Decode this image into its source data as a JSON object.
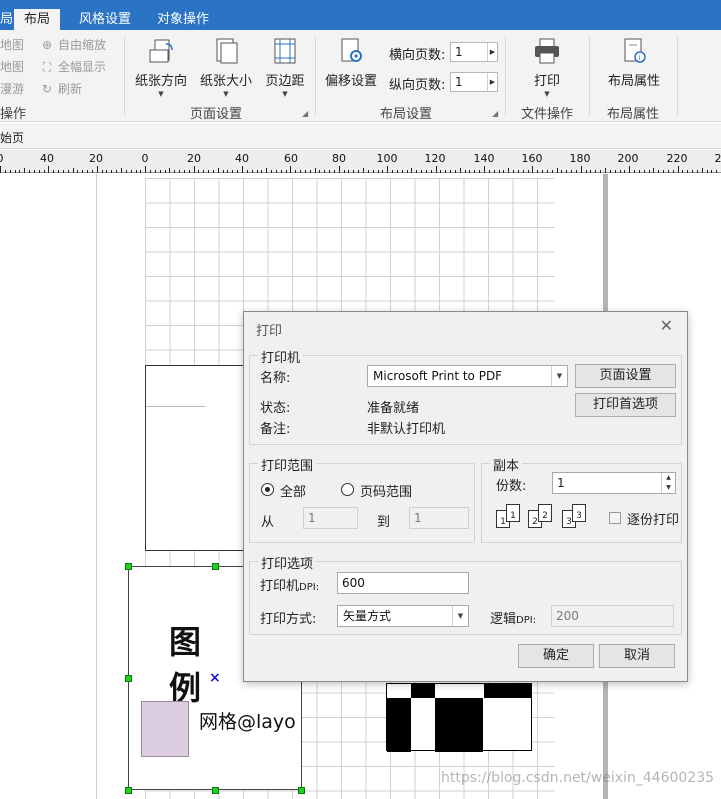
{
  "tabs": [
    {
      "label": "局"
    },
    {
      "label": "布局"
    },
    {
      "label": "风格设置"
    },
    {
      "label": "对象操作"
    }
  ],
  "ribbon": {
    "small_left": [
      "地图",
      "地图",
      "漫游"
    ],
    "small_mid": [
      "自由缩放",
      "全幅显示",
      "刷新"
    ],
    "group_left": "操作",
    "page_setup": {
      "orientation": "纸张方向",
      "size": "纸张大小",
      "margin": "页边距",
      "label": "页面设置"
    },
    "layout_setup": {
      "offset": "偏移设置",
      "h_pages_label": "横向页数:",
      "h_pages": "1",
      "v_pages_label": "纵向页数:",
      "v_pages": "1",
      "label": "布局设置"
    },
    "file_ops": {
      "print": "打印",
      "label": "文件操作"
    },
    "layout_props": {
      "btn": "布局属性",
      "label": "布局属性"
    }
  },
  "pagebar": {
    "text": "始页"
  },
  "ruler": {
    "labels": [
      "0",
      "40",
      "20",
      "0",
      "20",
      "40",
      "60",
      "80",
      "100",
      "120",
      "140",
      "160",
      "180",
      "200",
      "220",
      "2"
    ]
  },
  "canvas": {
    "legend_title": "图 例",
    "legend_item": "网格@layo",
    "watermark": "https://blog.csdn.net/weixin_44600235"
  },
  "dialog": {
    "title": "打印",
    "printer": {
      "group": "打印机",
      "name_label": "名称:",
      "name_value": "Microsoft Print to PDF",
      "status_label": "状态:",
      "status_value": "准备就绪",
      "comment_label": "备注:",
      "comment_value": "非默认打印机",
      "page_setup_btn": "页面设置",
      "pref_btn": "打印首选项"
    },
    "range": {
      "group": "打印范围",
      "all": "全部",
      "pages": "页码范围",
      "from_label": "从",
      "from": "1",
      "to_label": "到",
      "to": "1"
    },
    "copies": {
      "group": "副本",
      "count_label": "份数:",
      "count": "1",
      "collate": "逐份打印"
    },
    "options": {
      "group": "打印选项",
      "dpi_label_main": "打印机",
      "dpi_label_sub": "DPI:",
      "dpi": "600",
      "mode_label": "打印方式:",
      "mode": "矢量方式",
      "logic_label_main": "逻辑",
      "logic_label_sub": "DPI:",
      "logic_dpi": "200"
    },
    "ok": "确定",
    "cancel": "取消"
  },
  "colors": {
    "tabbar": "#2b73c4",
    "ribbon_bg": "#f3f3f3",
    "dialog_bg": "#f0f0f0",
    "legend_swatch": "#dccde0",
    "handle": "#1ed31e"
  }
}
